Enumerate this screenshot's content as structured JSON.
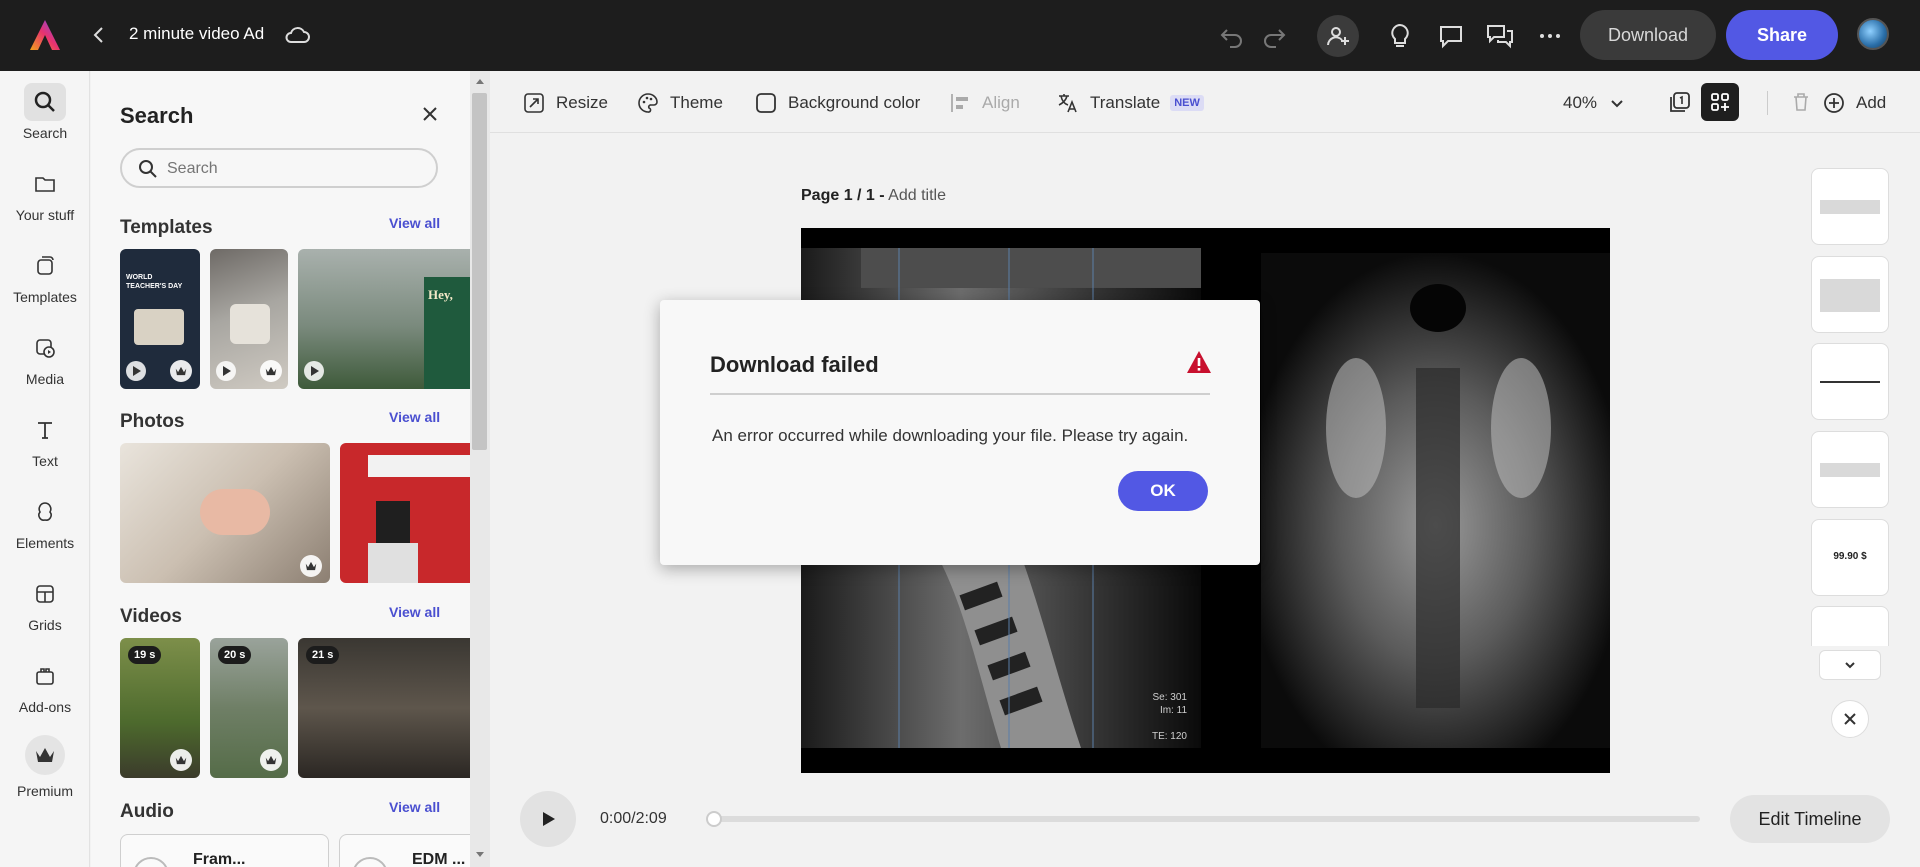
{
  "topbar": {
    "doc_title": "2 minute video Ad",
    "download_label": "Download",
    "share_label": "Share"
  },
  "rail": {
    "items": [
      {
        "label": "Search",
        "icon": "search-icon"
      },
      {
        "label": "Your stuff",
        "icon": "folder-icon"
      },
      {
        "label": "Templates",
        "icon": "templates-icon"
      },
      {
        "label": "Media",
        "icon": "media-icon"
      },
      {
        "label": "Text",
        "icon": "text-icon"
      },
      {
        "label": "Elements",
        "icon": "elements-icon"
      },
      {
        "label": "Grids",
        "icon": "grids-icon"
      },
      {
        "label": "Add-ons",
        "icon": "addons-icon"
      },
      {
        "label": "Premium",
        "icon": "crown-icon"
      }
    ]
  },
  "panel": {
    "title": "Search",
    "search_placeholder": "Search",
    "view_all": "View all",
    "sections": {
      "templates": "Templates",
      "photos": "Photos",
      "videos": "Videos",
      "audio": "Audio"
    },
    "template_texts": {
      "t1": "WORLD TEACHER'S DAY",
      "t3": "Hey,"
    },
    "videos": [
      {
        "duration": "19 s"
      },
      {
        "duration": "20 s"
      },
      {
        "duration": "21 s"
      }
    ],
    "audio": [
      {
        "title": "Fram..."
      },
      {
        "title": "EDM ..."
      }
    ]
  },
  "toolbar": {
    "resize": "Resize",
    "theme": "Theme",
    "background_color": "Background color",
    "align": "Align",
    "translate": "Translate",
    "new_badge": "NEW",
    "zoom": "40%",
    "add": "Add"
  },
  "canvas": {
    "page_prefix": "Page 1 / 1 -",
    "add_title": "Add title",
    "mri_text": [
      "Se: 301",
      "Im: 11",
      "TE: 120"
    ]
  },
  "pages_sidebar": {
    "price_text": "99.90 $"
  },
  "timeline": {
    "time": "0:00/2:09",
    "edit_label": "Edit Timeline",
    "progress": 0
  },
  "dialog": {
    "title": "Download failed",
    "message": "An error occurred while downloading your file. Please try again.",
    "ok_label": "OK"
  },
  "colors": {
    "accent": "#5258e4",
    "topbar_bg": "#1d1d1d",
    "warning": "#c8102e"
  }
}
